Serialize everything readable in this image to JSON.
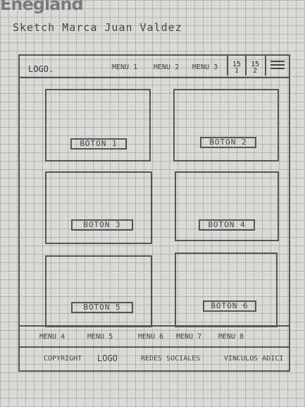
{
  "brand": "Enegland",
  "sketch_title": "Sketch Marca Juan Valdez",
  "header": {
    "logo": "LOGO.",
    "menu": [
      "MENU 1",
      "MENU 2",
      "MENU 3"
    ],
    "icon1": "15\n1",
    "icon2": "15\n2"
  },
  "cards": [
    {
      "button": "BOTON 1"
    },
    {
      "button": "BOTON 2"
    },
    {
      "button": "BOTON 3"
    },
    {
      "button": "BOTON 4"
    },
    {
      "button": "BOTON 5"
    },
    {
      "button": "BOTON 6"
    }
  ],
  "footer_menu": [
    "MENU 4",
    "MENU 5",
    "MENU 6",
    "MENU 7",
    "MENU 8"
  ],
  "footer_bottom": {
    "copyright": "COPYRIGHT",
    "logo": "LOGO",
    "social": "REDES SOCIALES",
    "links": "VINCULOS ADICI"
  }
}
